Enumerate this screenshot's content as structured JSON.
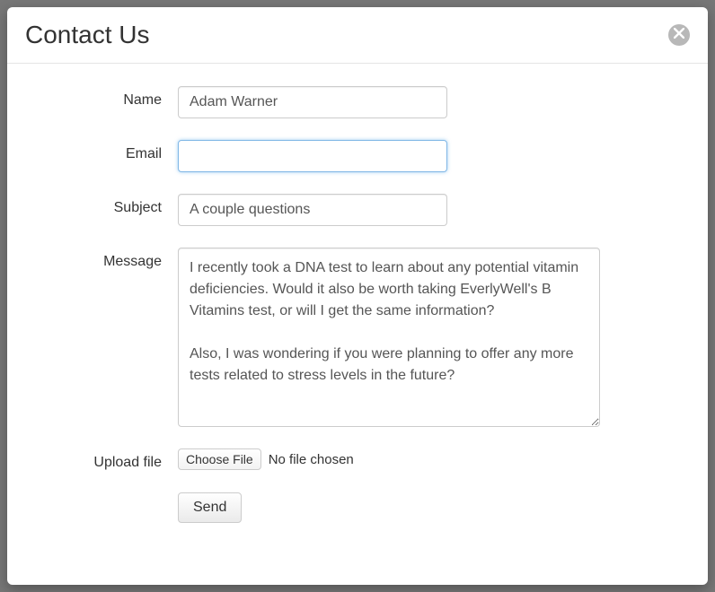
{
  "modal": {
    "title": "Contact Us"
  },
  "form": {
    "name": {
      "label": "Name",
      "value": "Adam Warner"
    },
    "email": {
      "label": "Email",
      "value": ""
    },
    "subject": {
      "label": "Subject",
      "value": "A couple questions"
    },
    "message": {
      "label": "Message",
      "value": "I recently took a DNA test to learn about any potential vitamin deficiencies. Would it also be worth taking EverlyWell's B Vitamins test, or will I get the same information?\n\nAlso, I was wondering if you were planning to offer any more tests related to stress levels in the future?"
    },
    "upload": {
      "label": "Upload file",
      "button": "Choose File",
      "status": "No file chosen"
    },
    "submit": {
      "label": "Send"
    }
  }
}
